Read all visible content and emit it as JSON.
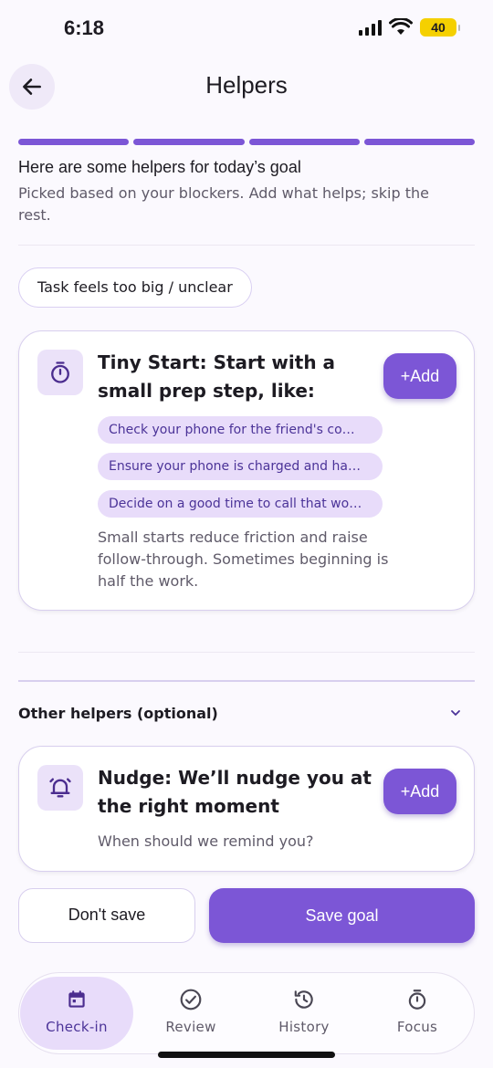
{
  "status": {
    "time": "6:18",
    "battery": "40"
  },
  "header": {
    "title": "Helpers"
  },
  "progress": {
    "steps_total": 4,
    "steps_completed": 4
  },
  "intro": {
    "title": "Here are some helpers for today’s goal",
    "subtitle": "Picked based on your blockers. Add what helps; skip the rest."
  },
  "blocker_chip": "Task feels too big / unclear",
  "tiny_start": {
    "icon": "timer-icon",
    "title": "Tiny Start: Start with a small prep step, like:",
    "add_label": "+Add",
    "suggestions": [
      "Check your phone for the friend's co…",
      "Ensure your phone is charged and ha…",
      "Decide on a good time to call that wo…"
    ],
    "description": "Small starts reduce friction and raise follow-through. Sometimes beginning is half the work."
  },
  "other_helpers": {
    "label": "Other helpers (optional)"
  },
  "nudge": {
    "icon": "bell-icon",
    "title": "Nudge: We’ll nudge you at the right moment",
    "add_label": "+Add",
    "description": "When should we remind you?"
  },
  "actions": {
    "dont_save": "Don't save",
    "save": "Save goal"
  },
  "nav": [
    {
      "label": "Check-in",
      "icon": "calendar-icon",
      "active": true
    },
    {
      "label": "Review",
      "icon": "check-circle-icon",
      "active": false
    },
    {
      "label": "History",
      "icon": "history-icon",
      "active": false
    },
    {
      "label": "Focus",
      "icon": "timer-icon",
      "active": false
    }
  ],
  "colors": {
    "accent": "#7c56d6",
    "chip_bg": "#e8dcfa",
    "chip_text": "#4b3398"
  }
}
